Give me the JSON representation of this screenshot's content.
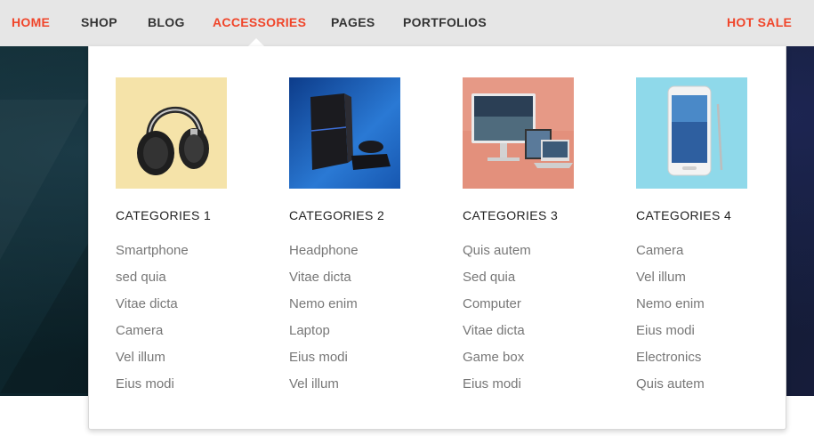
{
  "nav": {
    "items": [
      {
        "label": "HOME",
        "active": true
      },
      {
        "label": "SHOP"
      },
      {
        "label": "BLOG"
      },
      {
        "label": "ACCESSORIES",
        "active": true
      },
      {
        "label": "PAGES"
      },
      {
        "label": "PORTFOLIOS"
      }
    ],
    "hot_sale": "HOT SALE",
    "accent_color": "#f0452a"
  },
  "mega_menu": {
    "columns": [
      {
        "title": "CATEGORIES 1",
        "image": "headphones",
        "image_bg": "#f3df9f",
        "links": [
          "Smartphone",
          "sed quia",
          "Vitae dicta",
          "Camera",
          "Vel illum",
          "Eius modi"
        ]
      },
      {
        "title": "CATEGORIES 2",
        "image": "game-console",
        "image_bg": "#1d5fb5",
        "links": [
          "Headphone",
          "Vitae dicta",
          "Nemo enim",
          "Laptop",
          "Eius modi",
          "Vel illum"
        ]
      },
      {
        "title": "CATEGORIES 3",
        "image": "computer-devices",
        "image_bg": "#e3907c",
        "links": [
          "Quis autem",
          "Sed quia",
          "Computer",
          "Vitae dicta",
          "Game box",
          "Eius modi"
        ]
      },
      {
        "title": "CATEGORIES 4",
        "image": "smartphone",
        "image_bg": "#8fd9ea",
        "links": [
          "Camera",
          "Vel illum",
          "Nemo enim",
          "Eius modi",
          "Electronics",
          "Quis autem"
        ]
      }
    ]
  }
}
